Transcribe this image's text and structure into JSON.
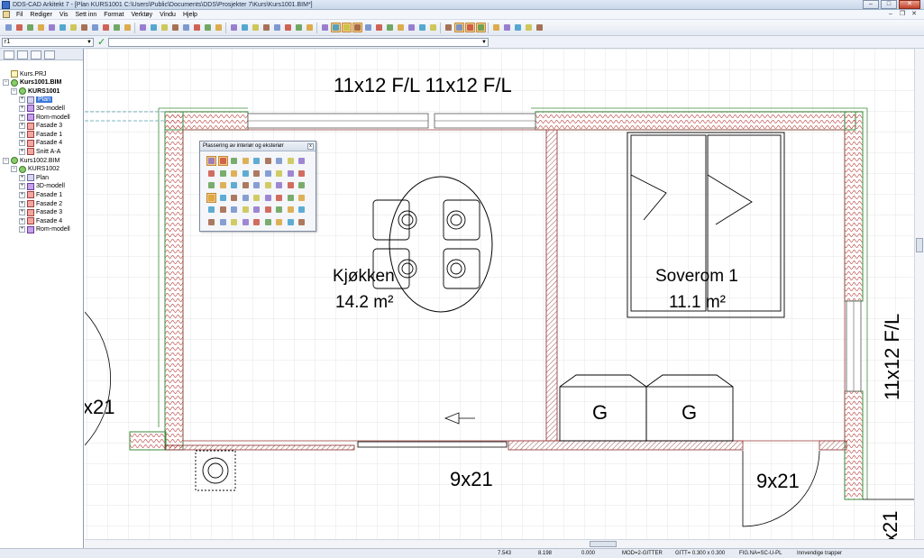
{
  "window": {
    "title": "DDS-CAD Arkitekt 7 - [Plan  KURS1001  C:\\Users\\Public\\Documents\\DDS\\Prosjekter 7\\Kurs\\Kurs1001.BIM*]",
    "minimize": "–",
    "maximize": "□",
    "close": "✕"
  },
  "menu": {
    "items": [
      "Fil",
      "Rediger",
      "Vis",
      "Sett inn",
      "Format",
      "Verktøy",
      "Vindu",
      "Hjelp"
    ],
    "doc_minimize": "–",
    "doc_restore": "❐",
    "doc_close": "✕"
  },
  "command_bar": {
    "command_value": "r1",
    "dropdown_arrow": "▼",
    "ok_icon": "✓",
    "input_value": ""
  },
  "project_tree": {
    "items": [
      {
        "label": "Kurs.PRJ",
        "level": 0,
        "icon": "project-icon",
        "expander": ""
      },
      {
        "label": "Kurs1001.BIM",
        "level": 0,
        "icon": "bim-icon",
        "expander": "−",
        "bold": true
      },
      {
        "label": "KURS1001",
        "level": 1,
        "icon": "bim-icon",
        "expander": "−",
        "bold": true
      },
      {
        "label": "Plan",
        "level": 2,
        "icon": "plan-icon",
        "expander": "+",
        "selected": true
      },
      {
        "label": "3D-modell",
        "level": 2,
        "icon": "model-3d-icon",
        "expander": "+"
      },
      {
        "label": "Rom-modell",
        "level": 2,
        "icon": "model-3d-icon",
        "expander": "+"
      },
      {
        "label": "Fasade 3",
        "level": 2,
        "icon": "facade-icon",
        "expander": "+"
      },
      {
        "label": "Fasade 1",
        "level": 2,
        "icon": "facade-icon",
        "expander": "+"
      },
      {
        "label": "Fasade 4",
        "level": 2,
        "icon": "facade-icon",
        "expander": "+"
      },
      {
        "label": "Snitt A-A",
        "level": 2,
        "icon": "section-icon",
        "expander": "+"
      },
      {
        "label": "Kurs1002.BIM",
        "level": 0,
        "icon": "bim-icon",
        "expander": "−"
      },
      {
        "label": "KURS1002",
        "level": 1,
        "icon": "bim-icon",
        "expander": "−"
      },
      {
        "label": "Plan",
        "level": 2,
        "icon": "plan-icon",
        "expander": "+"
      },
      {
        "label": "3D-modell",
        "level": 2,
        "icon": "model-3d-icon",
        "expander": "+"
      },
      {
        "label": "Fasade 1",
        "level": 2,
        "icon": "facade-icon",
        "expander": "+"
      },
      {
        "label": "Fasade 2",
        "level": 2,
        "icon": "facade-icon",
        "expander": "+"
      },
      {
        "label": "Fasade 3",
        "level": 2,
        "icon": "facade-icon",
        "expander": "+"
      },
      {
        "label": "Fasade 4",
        "level": 2,
        "icon": "facade-icon",
        "expander": "+"
      },
      {
        "label": "Rom-modell",
        "level": 2,
        "icon": "model-3d-icon",
        "expander": "+"
      }
    ]
  },
  "floating_panel": {
    "title": "Plassering av interiør og eksteriør",
    "close": "x"
  },
  "plan": {
    "window_tag_top": "11x12 F/L 11x12 F/L",
    "window_tag_right": "11x12 F/L",
    "door_tag_left": "x21",
    "door_tag_center": "9x21",
    "door_tag_right": "9x21",
    "door_tag_far_right": "x21",
    "kitchen_name": "Kjøkken",
    "kitchen_area": "14.2 m²",
    "bedroom_name": "Soverom 1",
    "bedroom_area": "11.1 m²",
    "wardrobe_left": "G",
    "wardrobe_right": "G"
  },
  "status": {
    "x_coord": "7.543",
    "y_coord": "8.198",
    "z_coord": "0.000",
    "mode": "MOD=2-GITTER",
    "grid": "GITT= 0.300 x 0.300",
    "figure": "FIG.NA=SC-U-PL",
    "hint": "Innvendige trapper"
  }
}
